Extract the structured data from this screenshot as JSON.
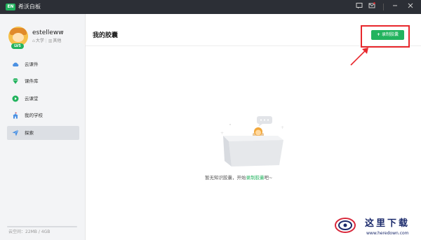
{
  "app": {
    "logo_text": "EN",
    "title": "希沃白板"
  },
  "titlebar": {
    "icons": [
      "feedback-icon",
      "message-icon",
      "minimize-icon",
      "close-icon"
    ]
  },
  "user": {
    "name": "estelleww",
    "level": "LV5",
    "stage": "大学",
    "subject": "其他"
  },
  "nav": [
    {
      "label": "云课件",
      "icon": "cloud-icon",
      "color": "#4a90e2"
    },
    {
      "label": "课件库",
      "icon": "diamond-icon",
      "color": "#22b35e"
    },
    {
      "label": "云课堂",
      "icon": "play-circle-icon",
      "color": "#22b35e"
    },
    {
      "label": "我的学校",
      "icon": "school-icon",
      "color": "#4a90e2"
    },
    {
      "label": "探索",
      "icon": "paper-plane-icon",
      "color": "#4a90e2",
      "active": true
    }
  ],
  "storage": {
    "label": "云空间：22MB / 4GB",
    "used_fraction": 0.005
  },
  "main": {
    "title": "我的胶囊",
    "record_button": "录制胶囊",
    "empty_prefix": "暂无知识胶囊，开始",
    "empty_link": "录制胶囊",
    "empty_suffix": "吧~"
  },
  "watermark": {
    "text": "这里下载",
    "url": "www.heredown.com"
  },
  "colors": {
    "accent": "#22b35e",
    "highlight": "#e8272c",
    "titlebar": "#2c2f36"
  }
}
